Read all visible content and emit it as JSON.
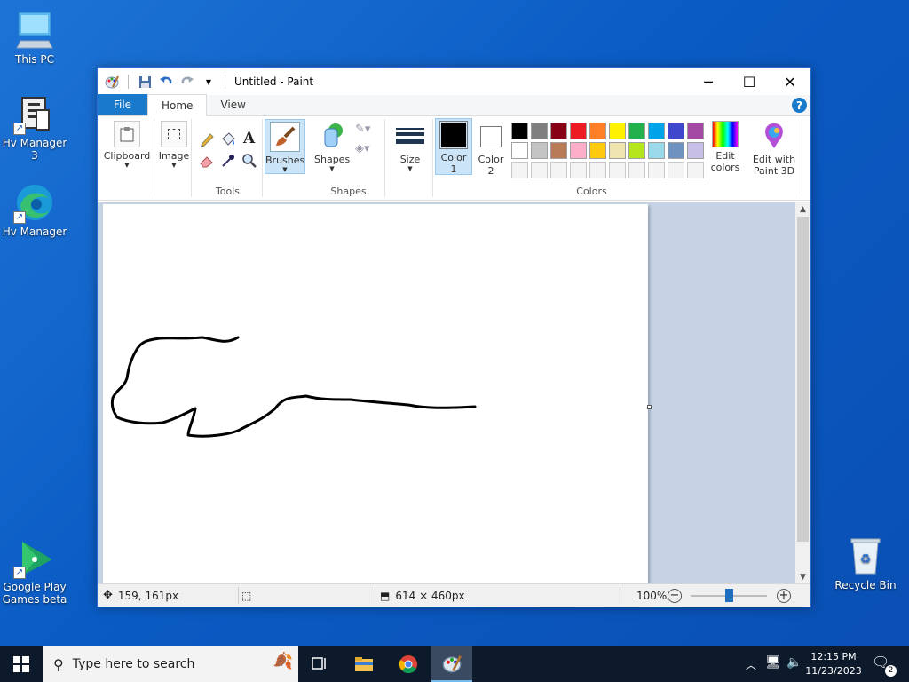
{
  "desktop": {
    "icons": [
      {
        "label": "This PC"
      },
      {
        "label": "Hv Manager 3"
      },
      {
        "label": "Hv Manager"
      },
      {
        "label": "Google Play Games beta"
      },
      {
        "label": "Recycle Bin"
      }
    ]
  },
  "window": {
    "title": "Untitled - Paint",
    "controls": {
      "minimize": "─",
      "maximize": "☐",
      "close": "✕"
    },
    "help": "?"
  },
  "tabs": [
    "File",
    "Home",
    "View"
  ],
  "ribbon": {
    "clipboard": {
      "label": "Clipboard"
    },
    "image": {
      "label": "Image"
    },
    "tools": {
      "group_label": "Tools",
      "text_tool": "A"
    },
    "brushes": {
      "label": "Brushes"
    },
    "shapes": {
      "label": "Shapes",
      "group_label": "Shapes"
    },
    "size": {
      "label": "Size"
    },
    "color1": {
      "line1": "Color",
      "line2": "1",
      "value": "#000000"
    },
    "color2": {
      "line1": "Color",
      "line2": "2",
      "value": "#ffffff"
    },
    "colors_group_label": "Colors",
    "palette_row1": [
      "#000000",
      "#7f7f7f",
      "#880015",
      "#ed1c24",
      "#ff7f27",
      "#fff200",
      "#22b14c",
      "#00a2e8",
      "#3f48cc",
      "#a349a4"
    ],
    "palette_row2": [
      "#ffffff",
      "#c3c3c3",
      "#b97a57",
      "#ffaec9",
      "#ffc90e",
      "#efe4b0",
      "#b5e61d",
      "#99d9ea",
      "#7092be",
      "#c8bfe7"
    ],
    "palette_row3_empty": 10,
    "edit_colors": {
      "line1": "Edit",
      "line2": "colors"
    },
    "edit_paint3d": {
      "line1": "Edit with",
      "line2": "Paint 3D"
    }
  },
  "status": {
    "cursor_pos": "159, 161px",
    "image_size": "614 × 460px",
    "zoom": "100%",
    "zoom_level": 0.5
  },
  "taskbar": {
    "search_placeholder": "Type here to search",
    "time": "12:15 PM",
    "date": "11/23/2023",
    "notifications": "2"
  }
}
